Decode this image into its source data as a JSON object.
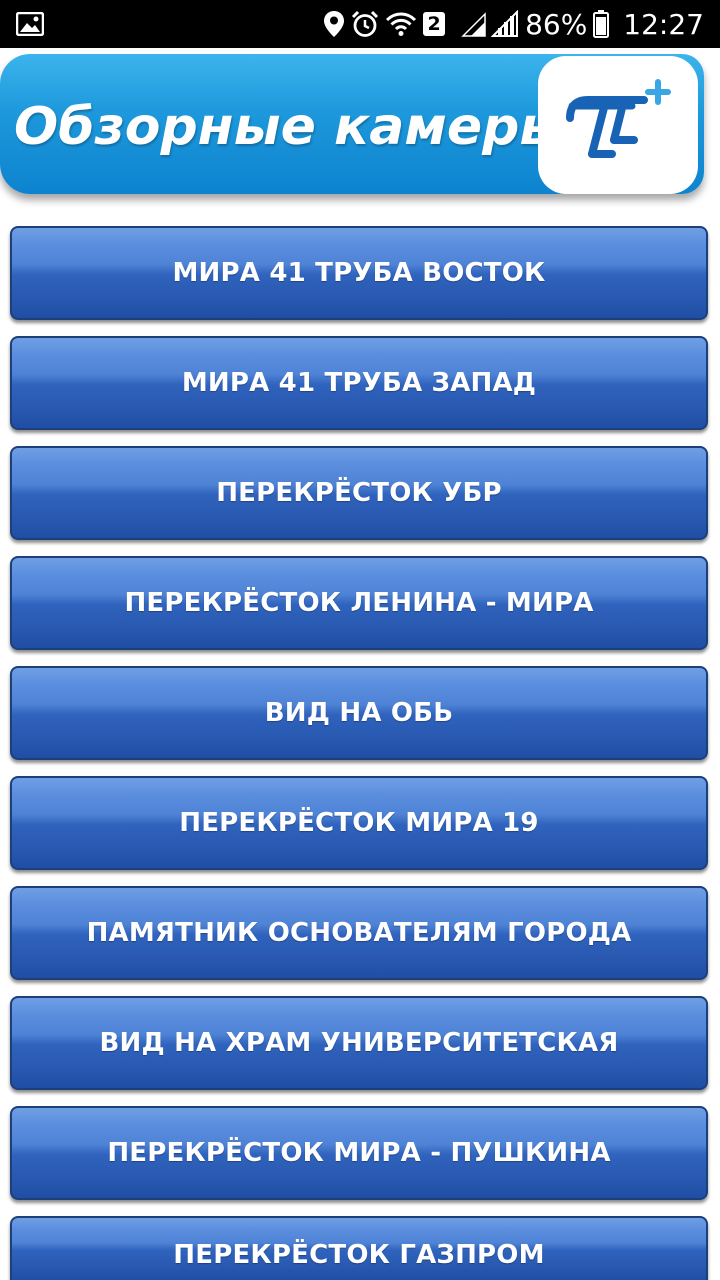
{
  "status_bar": {
    "battery_percent": "86%",
    "time": "12:27",
    "sim_badge": "2",
    "icons": [
      "gallery-icon",
      "location-icon",
      "alarm-icon",
      "wifi-icon",
      "signal-icon",
      "battery-icon"
    ]
  },
  "header": {
    "title": "Обзорные камеры",
    "logo_icon": "t-plus-logo-icon",
    "colors": {
      "gradient_top": "#3cb4ec",
      "gradient_bottom": "#0d83cf",
      "logo_stroke": "#1863b5"
    }
  },
  "cameras": [
    {
      "label": "МИРА 41 ТРУБА ВОСТОК"
    },
    {
      "label": "МИРА 41 ТРУБА ЗАПАД"
    },
    {
      "label": "ПЕРЕКРЁСТОК УБР"
    },
    {
      "label": "ПЕРЕКРЁСТОК ЛЕНИНА - МИРА"
    },
    {
      "label": "ВИД НА ОБЬ"
    },
    {
      "label": "ПЕРЕКРЁСТОК МИРА 19"
    },
    {
      "label": "ПАМЯТНИК ОСНОВАТЕЛЯМ ГОРОДА"
    },
    {
      "label": "ВИД НА ХРАМ УНИВЕРСИТЕТСКАЯ"
    },
    {
      "label": "ПЕРЕКРЁСТОК МИРА - ПУШКИНА"
    },
    {
      "label": "ПЕРЕКРЁСТОК ГАЗПРОМ"
    }
  ],
  "button_color": "#2f63bd"
}
